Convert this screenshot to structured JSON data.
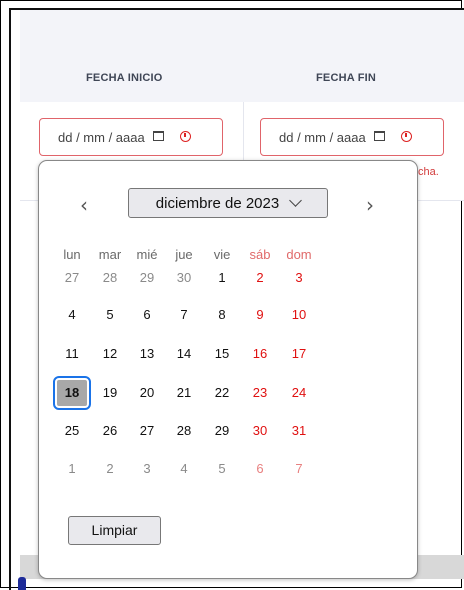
{
  "table": {
    "col_start": "FECHA INICIO",
    "col_end": "FECHA FIN",
    "start_input": {
      "placeholder": "dd / mm / aaaa"
    },
    "end_input": {
      "placeholder": "dd / mm / aaaa"
    },
    "error_fragment": "cha."
  },
  "colors": {
    "error": "#d23b3b",
    "weekend": "#e01010",
    "focus": "#1a73e8"
  },
  "calendar": {
    "month_label": "diciembre de 2023",
    "prev_icon": "chevron-left-icon",
    "next_icon": "chevron-right-icon",
    "weekdays": [
      {
        "label": "lun",
        "weekend": false
      },
      {
        "label": "mar",
        "weekend": false
      },
      {
        "label": "mié",
        "weekend": false
      },
      {
        "label": "jue",
        "weekend": false
      },
      {
        "label": "vie",
        "weekend": false
      },
      {
        "label": "sáb",
        "weekend": true
      },
      {
        "label": "dom",
        "weekend": true
      }
    ],
    "selected_day": "18",
    "weeks": [
      [
        {
          "d": "27",
          "other": true
        },
        {
          "d": "28",
          "other": true
        },
        {
          "d": "29",
          "other": true
        },
        {
          "d": "30",
          "other": true
        },
        {
          "d": "1"
        },
        {
          "d": "2",
          "wk": true
        },
        {
          "d": "3",
          "wk": true
        }
      ],
      [
        {
          "d": "4"
        },
        {
          "d": "5"
        },
        {
          "d": "6"
        },
        {
          "d": "7"
        },
        {
          "d": "8"
        },
        {
          "d": "9",
          "wk": true
        },
        {
          "d": "10",
          "wk": true
        }
      ],
      [
        {
          "d": "11"
        },
        {
          "d": "12"
        },
        {
          "d": "13"
        },
        {
          "d": "14"
        },
        {
          "d": "15"
        },
        {
          "d": "16",
          "wk": true
        },
        {
          "d": "17",
          "wk": true
        }
      ],
      [
        {
          "d": "18",
          "sel": true
        },
        {
          "d": "19"
        },
        {
          "d": "20"
        },
        {
          "d": "21"
        },
        {
          "d": "22"
        },
        {
          "d": "23",
          "wk": true
        },
        {
          "d": "24",
          "wk": true
        }
      ],
      [
        {
          "d": "25"
        },
        {
          "d": "26"
        },
        {
          "d": "27"
        },
        {
          "d": "28"
        },
        {
          "d": "29"
        },
        {
          "d": "30",
          "wk": true
        },
        {
          "d": "31",
          "wk": true
        }
      ],
      [
        {
          "d": "1",
          "other": true
        },
        {
          "d": "2",
          "other": true
        },
        {
          "d": "3",
          "other": true
        },
        {
          "d": "4",
          "other": true
        },
        {
          "d": "5",
          "other": true
        },
        {
          "d": "6",
          "other": true,
          "wk": true
        },
        {
          "d": "7",
          "other": true,
          "wk": true
        }
      ]
    ],
    "clear_label": "Limpiar"
  }
}
